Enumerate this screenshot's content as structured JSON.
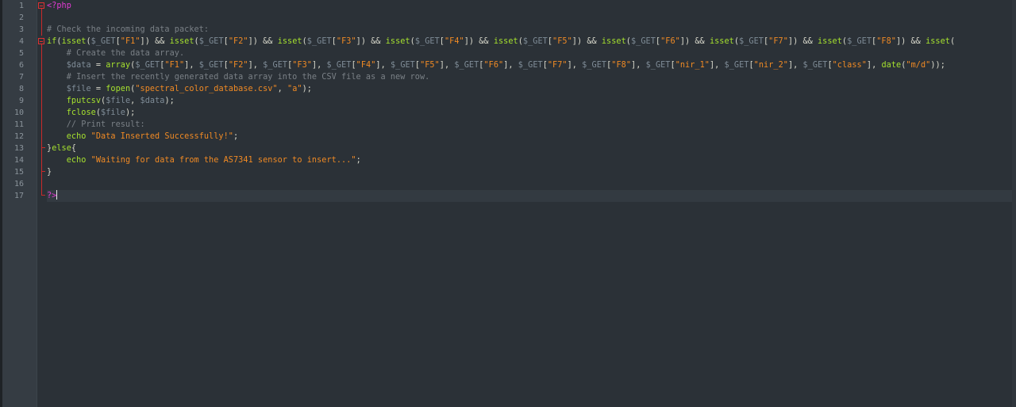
{
  "editor": {
    "language": "php",
    "active_line": 17,
    "colors": {
      "background": "#2b3137",
      "gutter": "#353c43",
      "keyword": "#a6e22e",
      "variable": "#7f8c97",
      "string": "#f08a24",
      "comment": "#7a8086",
      "php_tag": "#e13ad2",
      "fold_marker": "#e03131"
    },
    "line_numbers": [
      "1",
      "2",
      "3",
      "4",
      "5",
      "6",
      "7",
      "8",
      "9",
      "10",
      "11",
      "12",
      "13",
      "14",
      "15",
      "16",
      "17"
    ],
    "lines": [
      [
        [
          "php",
          "<?php"
        ]
      ],
      [],
      [
        [
          "cmt",
          "# Check the incoming data packet:"
        ]
      ],
      [
        [
          "kw",
          "if"
        ],
        [
          "pl",
          "("
        ],
        [
          "fn",
          "isset"
        ],
        [
          "pl",
          "("
        ],
        [
          "var",
          "$_GET"
        ],
        [
          "pl",
          "["
        ],
        [
          "str",
          "\"F1\""
        ],
        [
          "pl",
          "]) && "
        ],
        [
          "fn",
          "isset"
        ],
        [
          "pl",
          "("
        ],
        [
          "var",
          "$_GET"
        ],
        [
          "pl",
          "["
        ],
        [
          "str",
          "\"F2\""
        ],
        [
          "pl",
          "]) && "
        ],
        [
          "fn",
          "isset"
        ],
        [
          "pl",
          "("
        ],
        [
          "var",
          "$_GET"
        ],
        [
          "pl",
          "["
        ],
        [
          "str",
          "\"F3\""
        ],
        [
          "pl",
          "]) && "
        ],
        [
          "fn",
          "isset"
        ],
        [
          "pl",
          "("
        ],
        [
          "var",
          "$_GET"
        ],
        [
          "pl",
          "["
        ],
        [
          "str",
          "\"F4\""
        ],
        [
          "pl",
          "]) && "
        ],
        [
          "fn",
          "isset"
        ],
        [
          "pl",
          "("
        ],
        [
          "var",
          "$_GET"
        ],
        [
          "pl",
          "["
        ],
        [
          "str",
          "\"F5\""
        ],
        [
          "pl",
          "]) && "
        ],
        [
          "fn",
          "isset"
        ],
        [
          "pl",
          "("
        ],
        [
          "var",
          "$_GET"
        ],
        [
          "pl",
          "["
        ],
        [
          "str",
          "\"F6\""
        ],
        [
          "pl",
          "]) && "
        ],
        [
          "fn",
          "isset"
        ],
        [
          "pl",
          "("
        ],
        [
          "var",
          "$_GET"
        ],
        [
          "pl",
          "["
        ],
        [
          "str",
          "\"F7\""
        ],
        [
          "pl",
          "]) && "
        ],
        [
          "fn",
          "isset"
        ],
        [
          "pl",
          "("
        ],
        [
          "var",
          "$_GET"
        ],
        [
          "pl",
          "["
        ],
        [
          "str",
          "\"F8\""
        ],
        [
          "pl",
          "]) && "
        ],
        [
          "fn",
          "isset"
        ],
        [
          "pl",
          "("
        ]
      ],
      [
        [
          "pl",
          "    "
        ],
        [
          "cmt",
          "# Create the data array."
        ]
      ],
      [
        [
          "pl",
          "    "
        ],
        [
          "var",
          "$data"
        ],
        [
          "pl",
          " = "
        ],
        [
          "fn",
          "array"
        ],
        [
          "pl",
          "("
        ],
        [
          "var",
          "$_GET"
        ],
        [
          "pl",
          "["
        ],
        [
          "str",
          "\"F1\""
        ],
        [
          "pl",
          "], "
        ],
        [
          "var",
          "$_GET"
        ],
        [
          "pl",
          "["
        ],
        [
          "str",
          "\"F2\""
        ],
        [
          "pl",
          "], "
        ],
        [
          "var",
          "$_GET"
        ],
        [
          "pl",
          "["
        ],
        [
          "str",
          "\"F3\""
        ],
        [
          "pl",
          "], "
        ],
        [
          "var",
          "$_GET"
        ],
        [
          "pl",
          "["
        ],
        [
          "str",
          "\"F4\""
        ],
        [
          "pl",
          "], "
        ],
        [
          "var",
          "$_GET"
        ],
        [
          "pl",
          "["
        ],
        [
          "str",
          "\"F5\""
        ],
        [
          "pl",
          "], "
        ],
        [
          "var",
          "$_GET"
        ],
        [
          "pl",
          "["
        ],
        [
          "str",
          "\"F6\""
        ],
        [
          "pl",
          "], "
        ],
        [
          "var",
          "$_GET"
        ],
        [
          "pl",
          "["
        ],
        [
          "str",
          "\"F7\""
        ],
        [
          "pl",
          "], "
        ],
        [
          "var",
          "$_GET"
        ],
        [
          "pl",
          "["
        ],
        [
          "str",
          "\"F8\""
        ],
        [
          "pl",
          "], "
        ],
        [
          "var",
          "$_GET"
        ],
        [
          "pl",
          "["
        ],
        [
          "str",
          "\"nir_1\""
        ],
        [
          "pl",
          "], "
        ],
        [
          "var",
          "$_GET"
        ],
        [
          "pl",
          "["
        ],
        [
          "str",
          "\"nir_2\""
        ],
        [
          "pl",
          "], "
        ],
        [
          "var",
          "$_GET"
        ],
        [
          "pl",
          "["
        ],
        [
          "str",
          "\"class\""
        ],
        [
          "pl",
          "], "
        ],
        [
          "fn",
          "date"
        ],
        [
          "pl",
          "("
        ],
        [
          "str",
          "\"m/d\""
        ],
        [
          "pl",
          "));"
        ]
      ],
      [
        [
          "pl",
          "    "
        ],
        [
          "cmt",
          "# Insert the recently generated data array into the CSV file as a new row."
        ]
      ],
      [
        [
          "pl",
          "    "
        ],
        [
          "var",
          "$file"
        ],
        [
          "pl",
          " = "
        ],
        [
          "fn",
          "fopen"
        ],
        [
          "pl",
          "("
        ],
        [
          "str",
          "\"spectral_color_database.csv\""
        ],
        [
          "pl",
          ", "
        ],
        [
          "str",
          "\"a\""
        ],
        [
          "pl",
          ");"
        ]
      ],
      [
        [
          "pl",
          "    "
        ],
        [
          "fn",
          "fputcsv"
        ],
        [
          "pl",
          "("
        ],
        [
          "var",
          "$file"
        ],
        [
          "pl",
          ", "
        ],
        [
          "var",
          "$data"
        ],
        [
          "pl",
          ");"
        ]
      ],
      [
        [
          "pl",
          "    "
        ],
        [
          "fn",
          "fclose"
        ],
        [
          "pl",
          "("
        ],
        [
          "var",
          "$file"
        ],
        [
          "pl",
          ");"
        ]
      ],
      [
        [
          "pl",
          "    "
        ],
        [
          "cmt",
          "// Print result:"
        ]
      ],
      [
        [
          "pl",
          "    "
        ],
        [
          "kw",
          "echo"
        ],
        [
          "pl",
          " "
        ],
        [
          "str",
          "\"Data Inserted Successfully!\""
        ],
        [
          "pl",
          ";"
        ]
      ],
      [
        [
          "pl",
          "}"
        ],
        [
          "kw",
          "else"
        ],
        [
          "pl",
          "{"
        ]
      ],
      [
        [
          "pl",
          "    "
        ],
        [
          "kw",
          "echo"
        ],
        [
          "pl",
          " "
        ],
        [
          "str",
          "\"Waiting for data from the AS7341 sensor to insert...\""
        ],
        [
          "pl",
          ";"
        ]
      ],
      [
        [
          "pl",
          "}"
        ]
      ],
      [],
      [
        [
          "php",
          "?>"
        ]
      ]
    ]
  }
}
